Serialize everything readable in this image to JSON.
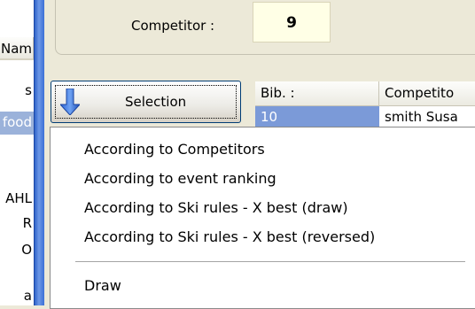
{
  "left_list": {
    "header": "Nam",
    "rows": [
      "s",
      "food",
      "",
      "AHL",
      "R",
      "O",
      "a"
    ],
    "selected_index": 1
  },
  "competitor": {
    "label": "Competitor :",
    "value": "9"
  },
  "selection_button": {
    "label": "Selection",
    "icon": "down-arrow-icon"
  },
  "grid": {
    "columns": [
      "Bib. :",
      "Competito"
    ],
    "rows": [
      {
        "bib": "10",
        "competitor": "smith Susa"
      }
    ]
  },
  "menu": {
    "items": [
      "According to Competitors",
      "According to event ranking",
      "According to Ski rules - X best (draw)",
      "According to Ski rules - X best (reversed)"
    ],
    "after_separator": [
      "Draw"
    ]
  },
  "colors": {
    "accent_blue": "#3c70d6",
    "selection_highlight": "#7b9ad8",
    "panel_bg": "#ECE9D8",
    "competitor_box_bg": "#ffffe6"
  }
}
